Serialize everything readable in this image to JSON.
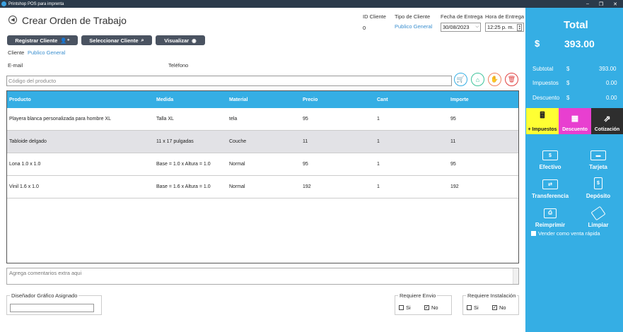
{
  "window": {
    "title": "Printshop POS para imprenta"
  },
  "header": {
    "title": "Crear Orden de Trabajo",
    "id_cliente_label": "ID Cliente",
    "id_cliente_value": "0",
    "tipo_cliente_label": "Tipo de Cliente",
    "tipo_cliente_value": "Publico General",
    "fecha_label": "Fecha de Entrega",
    "fecha_value": "30/08/2023",
    "hora_label": "Hora  de Entrega",
    "hora_value": "12:25 p. m."
  },
  "buttons": {
    "registrar": "Registrar Cliente",
    "seleccionar": "Seleccionar Cliente",
    "visualizar": "Visualizar"
  },
  "client": {
    "label": "Cliente",
    "value": "Publico General",
    "email_label": "E-mail",
    "telefono_label": "Teléfono"
  },
  "product_search": {
    "placeholder": "Código del producto"
  },
  "table": {
    "columns": [
      "Producto",
      "Medida",
      "Material",
      "Precio",
      "Cant",
      "Importe"
    ],
    "rows": [
      [
        "Playera blanca personalizada para hombre XL",
        "Talla XL",
        "tela",
        "95",
        "1",
        "95"
      ],
      [
        "Tabloide delgado",
        "11 x 17 pulgadas",
        "Couche",
        "11",
        "1",
        "11"
      ],
      [
        "Lona 1.0 x 1.0",
        "Base = 1.0 x Altura = 1.0",
        "Normal",
        "95",
        "1",
        "95"
      ],
      [
        "Vinil 1.6 x 1.0",
        "Base = 1.6 x Altura = 1.0",
        "Normal",
        "192",
        "1",
        "192"
      ]
    ]
  },
  "comments": {
    "placeholder": "Agrega comentarios extra aqui"
  },
  "designer": {
    "label": "Diseñador Gráfico Asignado",
    "value": ""
  },
  "envio": {
    "label": "Requiere Envio",
    "si": "Si",
    "no": "No"
  },
  "instalacion": {
    "label": "Requiere Instalación",
    "si": "Si",
    "no": "No"
  },
  "sidebar": {
    "total_label": "Total",
    "currency": "$",
    "total_value": "393.00",
    "subtotal_label": "Subtotal",
    "subtotal_value": "393.00",
    "impuestos_label": "Impuestos",
    "impuestos_value": "0.00",
    "descuento_label": "Descuento",
    "descuento_value": "0.00",
    "tiles": {
      "impuestos": "+ Impuestos",
      "descuento": "Descuento",
      "cotizacion": "Cotización"
    },
    "pay": {
      "efectivo": "Efectivo",
      "tarjeta": "Tarjeta",
      "transferencia": "Transferencia",
      "deposito": "Depósito",
      "reimprimir": "Reimprimir",
      "limpiar": "Limpiar"
    },
    "venta_rapida": "Vender como venta rápida"
  },
  "colors": {
    "accent": "#35aee4",
    "impuestos_tile": "#ffff33",
    "descuento_tile": "#e83fd0",
    "cotizacion_tile": "#2e2e2e",
    "button_dark": "#4a5361"
  }
}
